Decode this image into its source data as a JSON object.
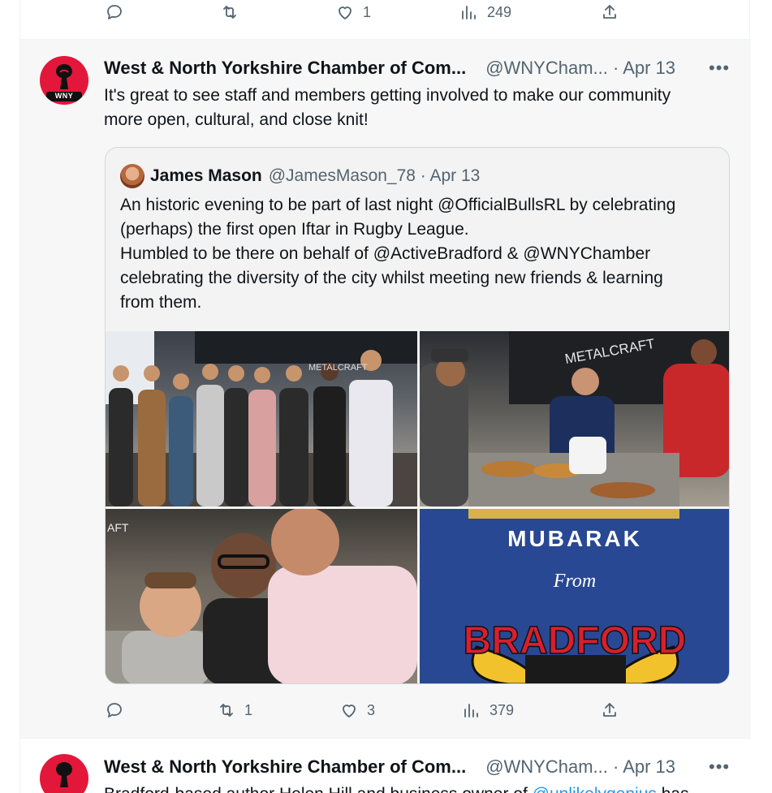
{
  "top_actions": {
    "reply_count": "",
    "retweet_count": "",
    "like_count": "1",
    "views_count": "249"
  },
  "tweet": {
    "author": "West & North Yorkshire Chamber of Com...",
    "handle_date": "@WNYCham... · Apr 13",
    "avatar_label": "WNY",
    "more": "•••",
    "text_line1": "It's great to see staff and members getting involved to make our community",
    "text_line2": "more open, cultural, and close knit!",
    "quote": {
      "author": "James Mason",
      "handle_date": "@JamesMason_78 · Apr 13",
      "lines": [
        "An historic evening to be part of last night @OfficialBullsRL by celebrating",
        "(perhaps) the first open Iftar in Rugby League.",
        "Humbled to be there on behalf of  @ActiveBradford & @WNYChamber",
        "celebrating the diversity of the city whilst meeting new friends & learning",
        "from them."
      ],
      "media": {
        "photo1_sign": "METALCRAFT",
        "photo2_sign": "METALCRAFT",
        "photo3_sign": "AFT",
        "poster_line1": "MUBARAK",
        "poster_line2": "From",
        "poster_line3": "BRADFORD"
      }
    },
    "actions": {
      "reply_count": "",
      "retweet_count": "1",
      "like_count": "3",
      "views_count": "379"
    }
  },
  "next_tweet": {
    "author": "West & North Yorkshire Chamber of Com...",
    "handle_date": "@WNYCham... · Apr 13",
    "more": "•••",
    "text_partial": "Bradford-based author Helen Hill and business owner of ",
    "mention_partial": "@unlikelygenius",
    "text_partial_end": " has"
  },
  "colors": {
    "accent": "#1d9bf0",
    "secondary_text": "#536471",
    "avatar_red": "#e3173a"
  }
}
